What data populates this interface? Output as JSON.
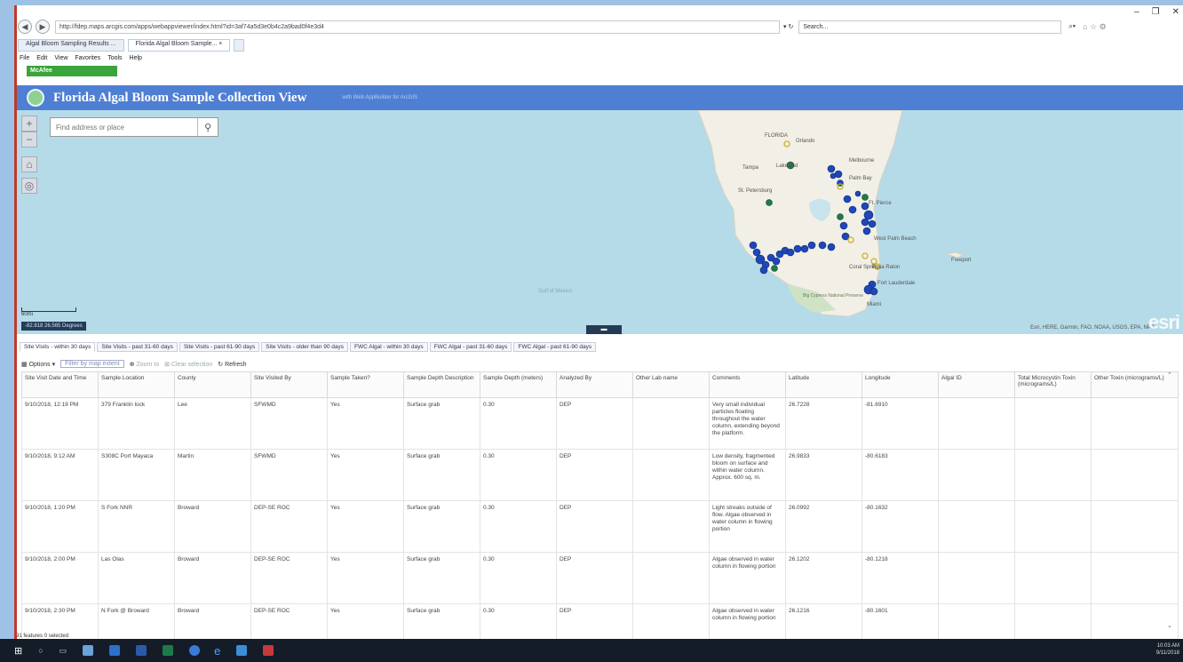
{
  "browser": {
    "url": "http://fdep.maps.arcgis.com/apps/webappviewer/index.html?id=3af74a5d3e0b4c2a9bad0f4e3d4",
    "search_placeholder": "Search...",
    "tabs": [
      {
        "label": "Algal Bloom Sampling Results ..."
      },
      {
        "label": "Florida Algal Bloom Sample... ×"
      }
    ],
    "menu": [
      "File",
      "Edit",
      "View",
      "Favorites",
      "Tools",
      "Help"
    ],
    "mcafee_label": "McAfee"
  },
  "app": {
    "title": "Florida Algal Bloom Sample Collection View",
    "subtitle": "with Web AppBuilder for ArcGIS"
  },
  "map": {
    "search_placeholder": "Find address or place",
    "coords": "-82.818 26.565 Degrees",
    "scale_label": "60mi",
    "attribution": "Esri, HERE, Garmin, FAO, NOAA, USGS, EPA, NPS",
    "logo_text": "esri",
    "labels": {
      "florida": "FLORIDA",
      "orlando": "Orlando",
      "tampa": "Tampa",
      "lakeland": "Lakeland",
      "stpete": "St. Petersburg",
      "melbourne": "Melbourne",
      "palmbay": "Palm Bay",
      "ftpierce": "Ft. Pierce",
      "westpalm": "West Palm Beach",
      "coralsprings": "Coral Springs",
      "bocaraton": "Boca Raton",
      "ftlaud": "Fort Lauderdale",
      "miami": "Miami",
      "freeport": "Freeport",
      "gulf": "Gulf of Mexico",
      "bigcypress": "Big Cypress National Preserve"
    },
    "colors": {
      "water": "#b5dbe8",
      "land": "#f2efe6",
      "sample_blue": "#1f47b8",
      "sample_green": "#1f7a4a",
      "sample_yellow": "#d6c236"
    }
  },
  "table": {
    "tabs": [
      "Site Visits - within 30 days",
      "Site Visits - past 31-60 days",
      "Site Visits - past 61-90 days",
      "Site Visits - older than 90 days",
      "FWC Algal - within 30 days",
      "FWC Algal - past 31-60 days",
      "FWC Algal - past 61-90 days"
    ],
    "tools": {
      "options": "Options ▾",
      "filter": "Filter by map extent",
      "zoom": "Zoom to",
      "clear": "Clear selection",
      "refresh": "Refresh"
    },
    "columns": [
      "Site Visit Date and Time",
      "Sample Location",
      "County",
      "Site Visited By",
      "Sample Taken?",
      "Sample Depth Description",
      "Sample Depth (meters)",
      "Analyzed By",
      "Other Lab name",
      "Comments",
      "Latitude",
      "Longitude",
      "Algal ID",
      "Total Microcystin Toxin (micrograms/L)",
      "Other Toxin (micrograms/L)"
    ],
    "rows": [
      [
        "9/10/2018, 12:19 PM",
        "379 Franklin lock",
        "Lee",
        "SFWMD",
        "Yes",
        "Surface grab",
        "0.30",
        "DEP",
        "",
        "Very small individual particles floating throughout the water column, extending beyond the platform.",
        "26.7228",
        "-81.6910",
        "",
        "",
        ""
      ],
      [
        "9/10/2018, 9:12 AM",
        "S308C Port Mayaca",
        "Martin",
        "SFWMD",
        "Yes",
        "Surface grab",
        "0.30",
        "DEP",
        "",
        "Low density, fragmented bloom on surface and within water column. Approx. 600 sq. m.",
        "26.9833",
        "-80.6183",
        "",
        "",
        ""
      ],
      [
        "9/10/2018, 1:20 PM",
        "S Fork NNR",
        "Broward",
        "DEP-SE ROC",
        "Yes",
        "Surface grab",
        "0.30",
        "DEP",
        "",
        "Light streaks outside of flow. Algae observed in water column in flowing portion",
        "26.0992",
        "-80.1632",
        "",
        "",
        ""
      ],
      [
        "9/10/2018, 2:00 PM",
        "Las Olas",
        "Broward",
        "DEP-SE ROC",
        "Yes",
        "Surface grab",
        "0.30",
        "DEP",
        "",
        "Algae observed in water column in flowing portion",
        "26.1202",
        "-80.1218",
        "",
        "",
        ""
      ],
      [
        "9/10/2018, 2:30 PM",
        "N Fork @ Broward",
        "Broward",
        "DEP-SE ROC",
        "Yes",
        "Surface grab",
        "0.30",
        "DEP",
        "",
        "Algae observed in water column in flowing portion",
        "26.1216",
        "-80.1601",
        "",
        "",
        ""
      ]
    ],
    "status": "91 features 0 selected"
  },
  "taskbar": {
    "time": "10:03 AM",
    "date": "9/11/2018"
  }
}
